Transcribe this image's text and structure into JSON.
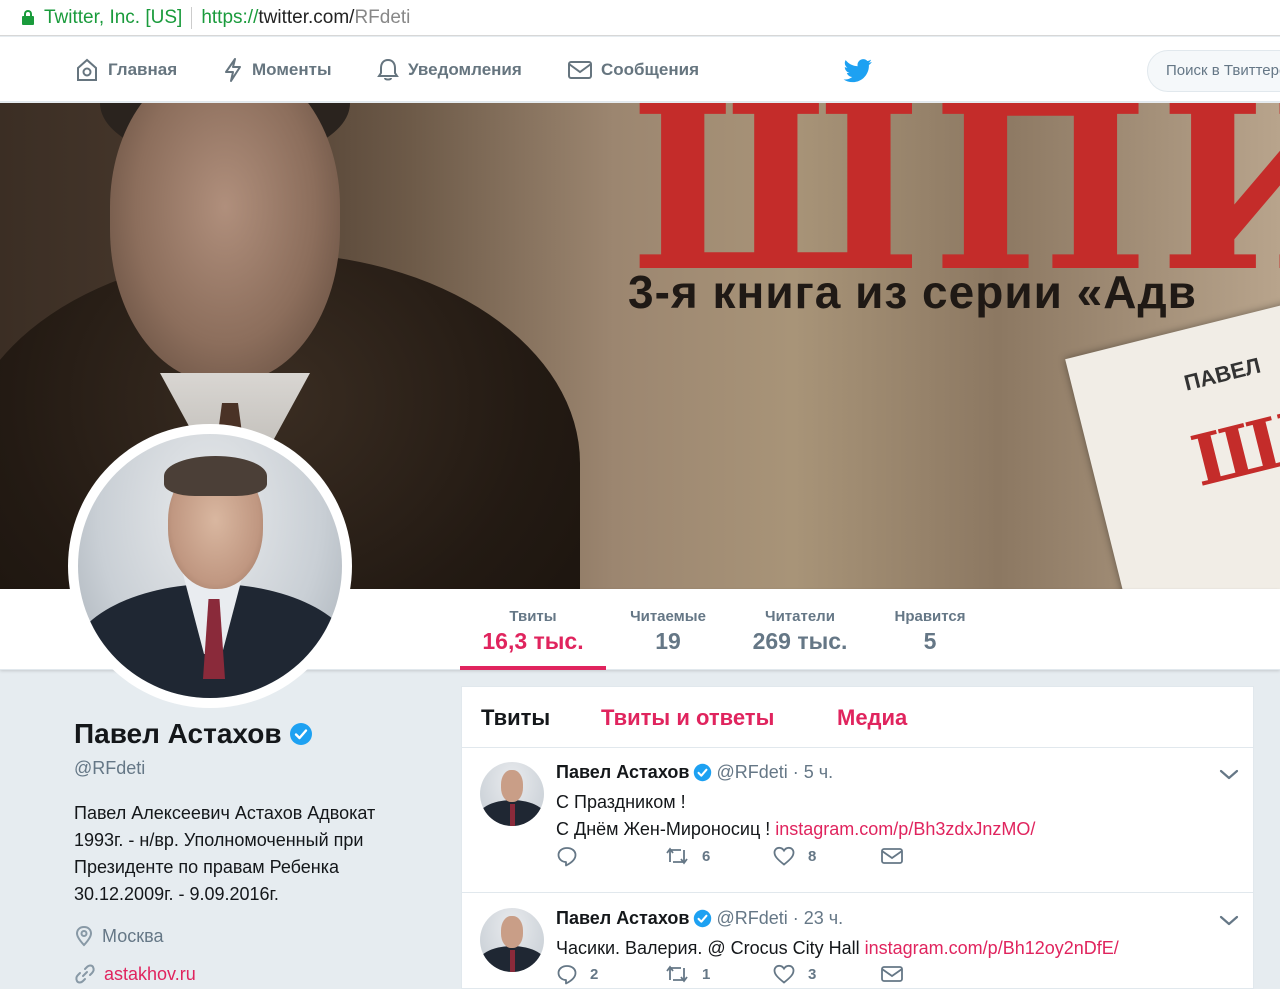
{
  "browser": {
    "org": "Twitter, Inc. [US]",
    "protocol": "https://",
    "host": "twitter.com/",
    "path": "RFdeti"
  },
  "nav": {
    "items": [
      {
        "label": "Главная",
        "icon": "home-icon"
      },
      {
        "label": "Моменты",
        "icon": "lightning-icon"
      },
      {
        "label": "Уведомления",
        "icon": "bell-icon"
      },
      {
        "label": "Сообщения",
        "icon": "envelope-icon"
      }
    ],
    "search_placeholder": "Поиск в Твиттере"
  },
  "banner": {
    "title_text": "ШПИ",
    "subtitle_text": "3-я книга из серии «Адв",
    "book_text_top": "ПАВЕЛ",
    "book_text_red": "ШП"
  },
  "stats": [
    {
      "label": "Твиты",
      "value": "16,3 тыс.",
      "active": true
    },
    {
      "label": "Читаемые",
      "value": "19",
      "active": false
    },
    {
      "label": "Читатели",
      "value": "269 тыс.",
      "active": false
    },
    {
      "label": "Нравится",
      "value": "5",
      "active": false
    }
  ],
  "profile": {
    "name": "Павел Астахов",
    "handle": "@RFdeti",
    "bio": "Павел Алексеевич Астахов Адвокат 1993г. - н/вр. Уполномоченный при Президенте по правам Ребенка 30.12.2009г. - 9.09.2016г.",
    "location": "Москва",
    "url": "astakhov.ru"
  },
  "timeline": {
    "tabs": [
      {
        "label": "Твиты",
        "active": true
      },
      {
        "label": "Твиты и ответы",
        "active": false
      },
      {
        "label": "Медиа",
        "active": false
      }
    ],
    "tweets": [
      {
        "name": "Павел Астахов",
        "handle": "@RFdeti",
        "time": "5 ч.",
        "line1": "С Праздником !",
        "line2_text": "С Днём Жен-Мироносиц ! ",
        "line2_link": "instagram.com/p/Bh3zdxJnzMO/",
        "retweets": "6",
        "likes": "8"
      },
      {
        "name": "Павел Астахов",
        "handle": "@RFdeti",
        "time": "23 ч.",
        "line1_text": "Часики. Валерия. @ Crocus City Hall ",
        "line1_link": "instagram.com/p/Bh12oy2nDfE/",
        "replies": "2",
        "retweets": "1",
        "likes": "3"
      }
    ]
  },
  "colors": {
    "accent": "#e0245e",
    "secure_green": "#1a9b3c",
    "verified_blue": "#1da1f2",
    "muted_text": "#657786",
    "background": "#e6ecf0"
  }
}
